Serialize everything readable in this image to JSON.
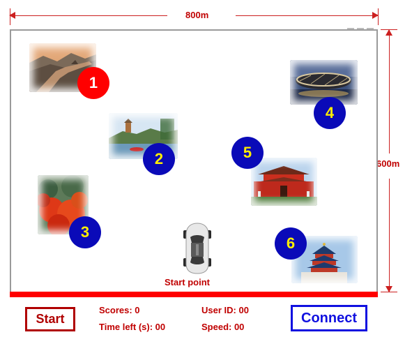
{
  "dimensions": {
    "width_label": "800m",
    "height_label": "600m"
  },
  "landmarks": [
    {
      "number": "1",
      "name": "great-wall",
      "marker_color": "red"
    },
    {
      "number": "2",
      "name": "summer-palace",
      "marker_color": "blue"
    },
    {
      "number": "3",
      "name": "autumn-forest",
      "marker_color": "blue"
    },
    {
      "number": "4",
      "name": "birds-nest-stadium",
      "marker_color": "blue"
    },
    {
      "number": "5",
      "name": "tiananmen",
      "marker_color": "blue"
    },
    {
      "number": "6",
      "name": "temple-of-heaven",
      "marker_color": "blue"
    }
  ],
  "start_point_label": "Start point",
  "panel": {
    "start_button": "Start",
    "scores": "Scores: 0",
    "time_left": "Time left (s): 00",
    "user_id": "User ID: 00",
    "speed": "Speed: 00",
    "connect_button": "Connect"
  },
  "colors": {
    "red": "#ff0000",
    "blue_marker": "#0a0ab8",
    "label_red": "#c00000",
    "connect_blue": "#1010e0"
  }
}
